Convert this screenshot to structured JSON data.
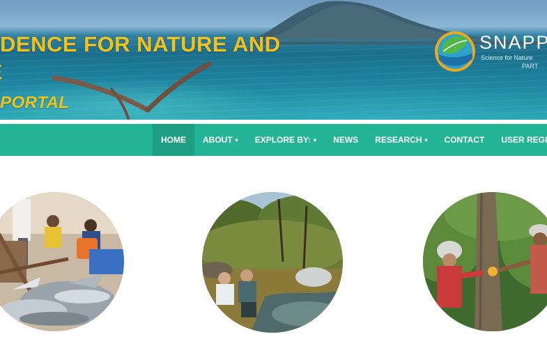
{
  "hero": {
    "title_line1": "DENCE FOR NATURE AND",
    "title_line2": "PLE",
    "subtitle": "PORTAL"
  },
  "logo": {
    "name": "SNAPP",
    "tagline": "Science for Nature",
    "partner": "PART"
  },
  "nav": {
    "items": [
      {
        "label": "HOME",
        "active": true
      },
      {
        "label": "ABOUT",
        "dropdown": true
      },
      {
        "label": "EXPLORE BY:",
        "dropdown": true
      },
      {
        "label": "NEWS"
      },
      {
        "label": "RESEARCH",
        "dropdown": true
      },
      {
        "label": "CONTACT"
      },
      {
        "label": "USER REGISTR"
      }
    ],
    "caret": "▾"
  },
  "colors": {
    "nav_bg": "#23b495",
    "nav_active": "#1e9e83",
    "title_yellow": "#f2c21a"
  },
  "features": [
    {
      "image": "fish-market-photo"
    },
    {
      "image": "forest-stream-researchers-photo"
    },
    {
      "image": "tree-measurement-photo"
    }
  ]
}
